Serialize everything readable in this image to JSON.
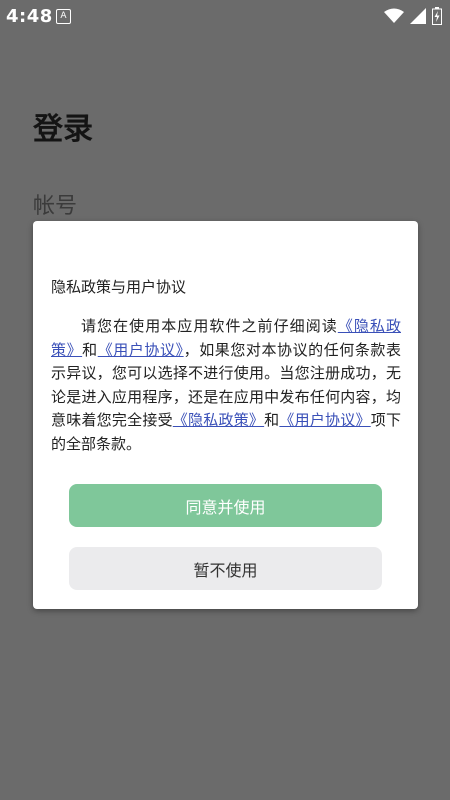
{
  "status_bar": {
    "time": "4:48",
    "notification_letter": "A"
  },
  "background": {
    "title": "登录",
    "account_label": "帐号"
  },
  "dialog": {
    "title": "隐私政策与用户协议",
    "body": {
      "part1": "请您在使用本应用软件之前仔细阅读",
      "link_privacy_1": "《隐私政策》",
      "part2": "和",
      "link_terms_1": "《用户协议》",
      "part3": "，如果您对本协议的任何条款表示异议，您可以选择不进行使用。当您注册成功，无论是进入应用程序，还是在应用中发布任何内容，均意味着您完全接受",
      "link_privacy_2": "《隐私政策》",
      "part4": "和",
      "link_terms_2": "《用户协议》",
      "part5": "项下的全部条款。"
    },
    "agree_button": "同意并使用",
    "decline_button": "暂不使用"
  },
  "colors": {
    "overlay": "#6b6b6b",
    "link": "#3a50b8",
    "agree_button": "#7fc79a",
    "decline_button": "#ebebed"
  },
  "icons": {
    "status_right": [
      "wifi-icon",
      "signal-icon",
      "battery-icon"
    ]
  }
}
